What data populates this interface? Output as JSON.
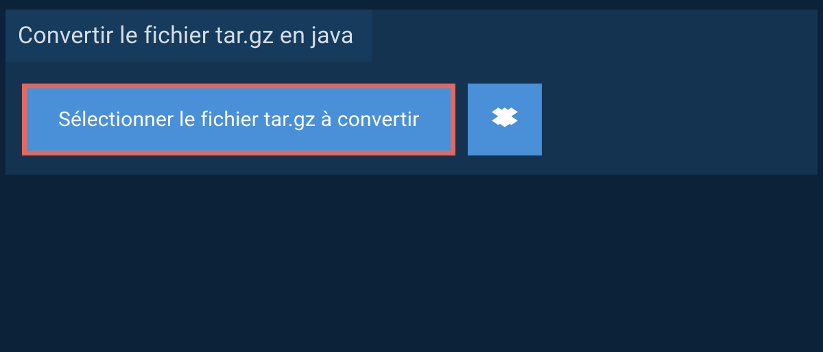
{
  "header": {
    "title": "Convertir le fichier tar.gz en java"
  },
  "actions": {
    "select_label": "Sélectionner le fichier tar.gz à convertir"
  }
}
